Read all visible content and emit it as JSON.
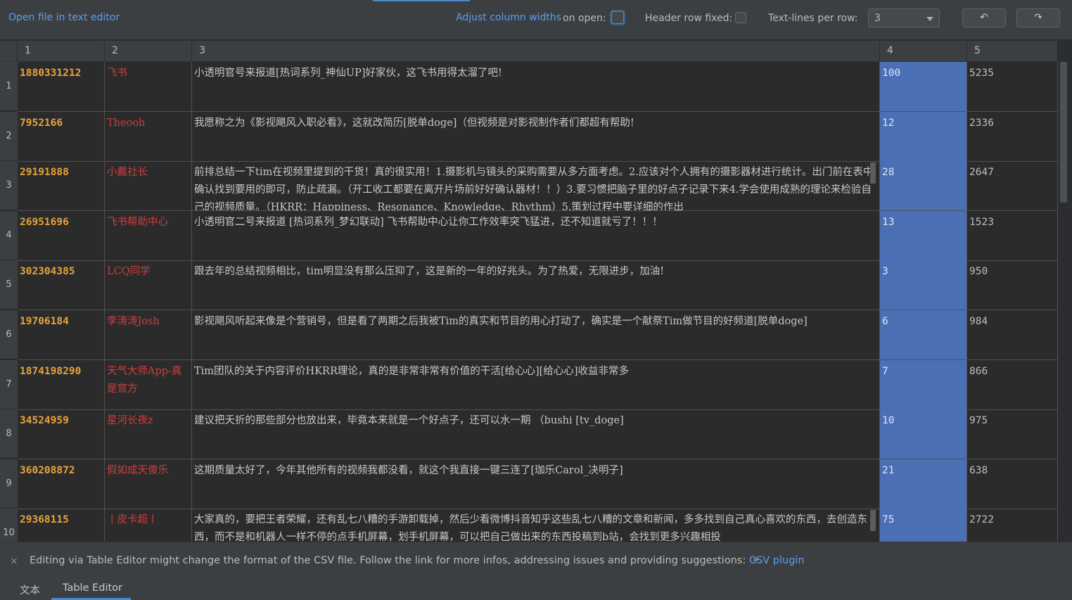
{
  "toolbar": {
    "open_file_label": "Open file in text editor",
    "adjust_link": "Adjust column widths",
    "adjust_suffix": "on open:",
    "header_fixed_label": "Header row fixed:",
    "lines_per_row_label": "Text-lines per row:",
    "lines_per_row_value": "3",
    "undo_icon": "undo-icon",
    "redo_icon": "redo-icon",
    "undo_glyph": "↶",
    "redo_glyph": "↷"
  },
  "table": {
    "headers": [
      "1",
      "2",
      "3",
      "4",
      "5"
    ],
    "rows": [
      {
        "n": "1",
        "c1": "1880331212",
        "c2": "飞书",
        "c3": "小透明官号来报道[热词系列_神仙UP]好家伙，这飞书用得太溜了吧!",
        "c4": "100",
        "c5": "5235"
      },
      {
        "n": "2",
        "c1": "7952166",
        "c2": "Theooh",
        "c3": "我愿称之为《影视飓风入职必看》，这就改简历[脱单doge]（但视频是对影视制作者们都超有帮助!",
        "c4": "12",
        "c5": "2336"
      },
      {
        "n": "3",
        "c1": "29191888",
        "c2": "小戴社长",
        "c3": "前排总结一下tim在视频里提到的干货！真的很实用！1.摄影机与镜头的采购需要从多方面考虑。2.应该对个人拥有的摄影器材进行统计。出门前在表中确认找到要用的即可，防止疏漏。（开工收工都要在离开片场前好好确认器材！！）3.要习惯把脑子里的好点子记录下来4.学会使用成熟的理论来检验自己的视频质量。（HKRR：Happiness、Resonance、Knowledge、Rhythm）5.策划过程中要详细的作出",
        "c4": "28",
        "c5": "2647"
      },
      {
        "n": "4",
        "c1": "26951696",
        "c2": "飞书帮助中心",
        "c3": "小透明官二号来报道 [热词系列_梦幻联动] 飞书帮助中心让你工作效率突飞猛进，还不知道就亏了！！！",
        "c4": "13",
        "c5": "1523"
      },
      {
        "n": "5",
        "c1": "302304385",
        "c2": "LCQ同学",
        "c3": "跟去年的总结视频相比，tim明显没有那么压抑了，这是新的一年的好兆头。为了热爱，无限进步，加油!",
        "c4": "3",
        "c5": "950"
      },
      {
        "n": "6",
        "c1": "19706184",
        "c2": "李涛涛Josh",
        "c3": "影视飓风听起来像是个营销号，但是看了两期之后我被Tim的真实和节目的用心打动了，确实是一个献祭Tim做节目的好频道[脱单doge]",
        "c4": "6",
        "c5": "984"
      },
      {
        "n": "7",
        "c1": "1874198290",
        "c2": "天气大师App-真是官方",
        "c3": "Tim团队的关于内容评价HKRR理论，真的是非常非常有价值的干活[给心心][给心心]收益非常多",
        "c4": "7",
        "c5": "866"
      },
      {
        "n": "8",
        "c1": "34524959",
        "c2": "星河长夜z",
        "c3": "建议把夭折的那些部分也放出来，毕竟本来就是一个好点子，还可以水一期 （bushi [tv_doge]",
        "c4": "10",
        "c5": "975"
      },
      {
        "n": "9",
        "c1": "360208872",
        "c2": "假如成天傻乐",
        "c3": "这期质量太好了，今年其他所有的视频我都没看，就这个我直接一键三连了[珈乐Carol_决明子]",
        "c4": "21",
        "c5": "638"
      },
      {
        "n": "10",
        "c1": "29368115",
        "c2": "丨皮卡超丨",
        "c3": "大家真的，要把王者荣耀，还有乱七八糟的手游卸载掉，然后少看微博抖音知乎这些乱七八糟的文章和新闻，多多找到自己真心喜欢的东西，去创造东西，而不是和机器人一样不停的点手机屏幕，划手机屏幕，可以把自己做出来的东西投稿到b站，会找到更多兴趣相投",
        "c4": "75",
        "c5": "2722"
      }
    ]
  },
  "notice": {
    "close_glyph": "×",
    "message": "Editing via Table Editor might change the format of the CSV file. Follow the link for more infos, addressing issues and providing suggestions:",
    "link": "CSV plugin",
    "chevron": "»"
  },
  "tabs": {
    "text": "文本",
    "table_editor": "Table Editor"
  },
  "colors": {
    "selected_column": "#4a6fb5",
    "id_text": "#e8a33d",
    "name_text": "#cc3e3e",
    "link": "#589df6"
  }
}
